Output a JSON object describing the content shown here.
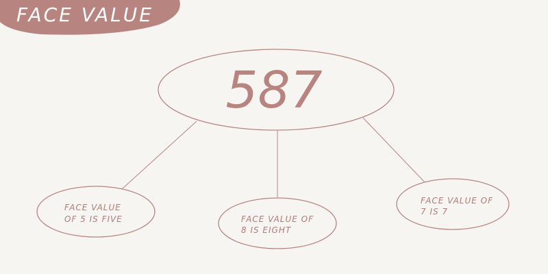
{
  "title": "FACE VALUE",
  "number": "587",
  "nodes": [
    {
      "line1": "FACE VALUE",
      "line2": "OF 5 IS FIVE"
    },
    {
      "line1": "FACE VALUE OF",
      "line2": "8 IS EIGHT"
    },
    {
      "line1": "FACE VALUE OF",
      "line2": "7 IS 7"
    }
  ],
  "colors": {
    "background": "#f7f5f2",
    "accent": "#b88480",
    "banner_text": "#ffffff"
  }
}
